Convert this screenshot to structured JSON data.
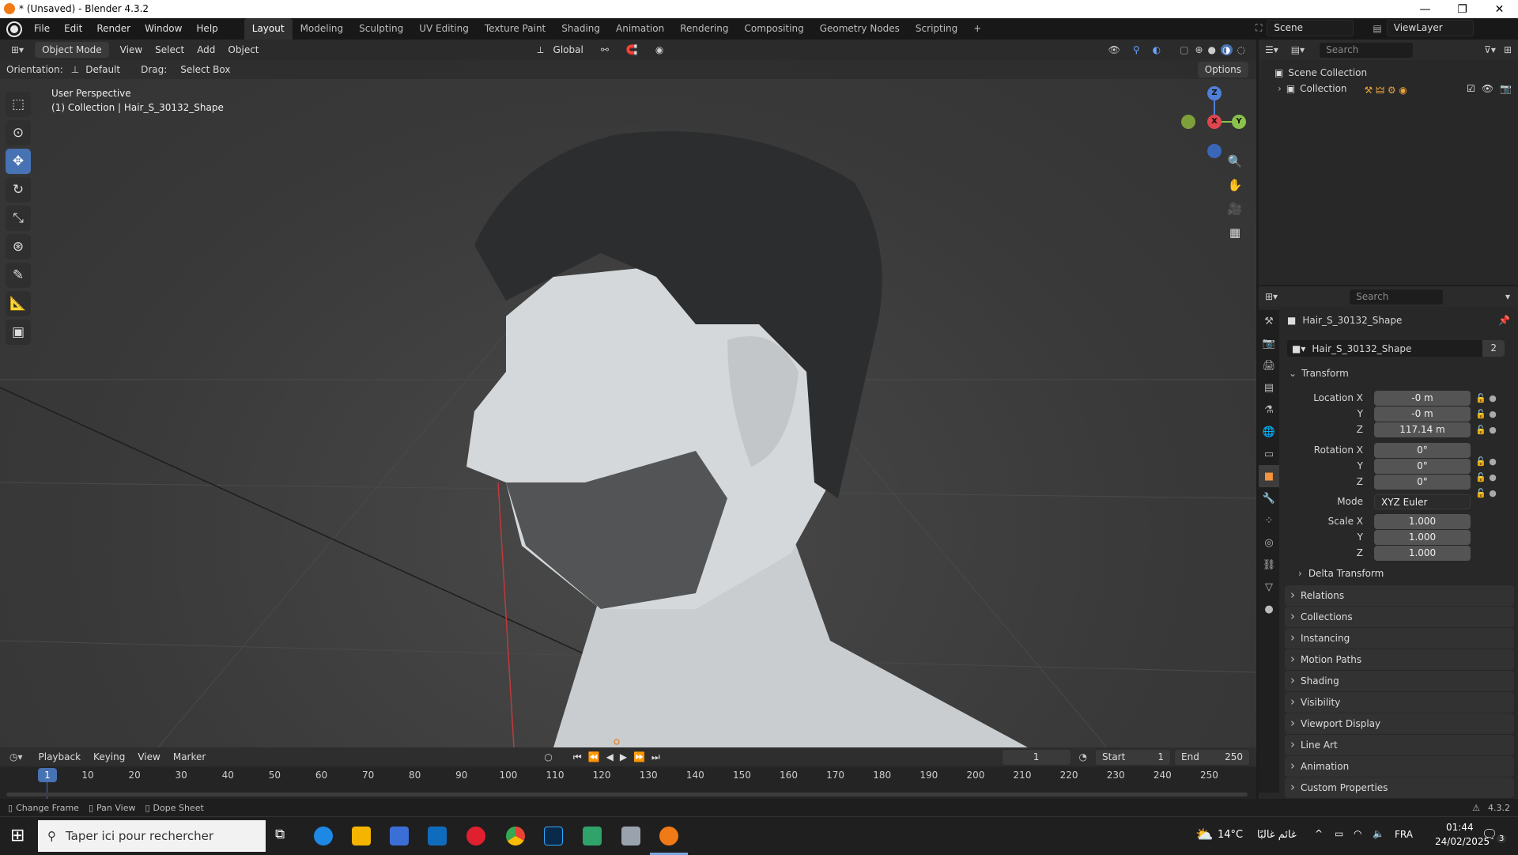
{
  "window": {
    "title": "* (Unsaved) - Blender 4.3.2",
    "controls": [
      "—",
      "❐",
      "✕"
    ]
  },
  "menu": [
    "File",
    "Edit",
    "Render",
    "Window",
    "Help"
  ],
  "workspaces": [
    "Layout",
    "Modeling",
    "Sculpting",
    "UV Editing",
    "Texture Paint",
    "Shading",
    "Animation",
    "Rendering",
    "Compositing",
    "Geometry Nodes",
    "Scripting",
    "+"
  ],
  "active_workspace": "Layout",
  "scene": {
    "label": "Scene",
    "view_layer": "ViewLayer"
  },
  "viewport": {
    "mode": "Object Mode",
    "header_menus": [
      "View",
      "Select",
      "Add",
      "Object"
    ],
    "transform_orientation": "Global",
    "orientation_label": "Orientation:",
    "orientation_value": "Default",
    "drag_label": "Drag:",
    "drag_value": "Select Box",
    "options": "Options",
    "perspective": "User Perspective",
    "active_info": "(1) Collection | Hair_S_30132_Shape",
    "gizmo": {
      "x": "X",
      "y": "Y",
      "z": "Z"
    }
  },
  "outliner": {
    "search_placeholder": "Search",
    "scene_collection": "Scene Collection",
    "collection": "Collection"
  },
  "properties": {
    "search_placeholder": "Search",
    "object_name": "Hair_S_30132_Shape",
    "data_name": "Hair_S_30132_Shape",
    "users": "2",
    "transform": {
      "title": "Transform",
      "location_label": "Location X",
      "location": [
        "-0 m",
        "-0 m",
        "117.14 m"
      ],
      "rotation_label": "Rotation X",
      "rotation": [
        "0°",
        "0°",
        "0°"
      ],
      "mode_label": "Mode",
      "mode": "XYZ Euler",
      "scale_label": "Scale X",
      "scale": [
        "1.000",
        "1.000",
        "1.000"
      ],
      "y_label": "Y",
      "z_label": "Z",
      "delta": "Delta Transform"
    },
    "panels": [
      "Relations",
      "Collections",
      "Instancing",
      "Motion Paths",
      "Shading",
      "Visibility",
      "Viewport Display",
      "Line Art",
      "Animation",
      "Custom Properties"
    ]
  },
  "timeline": {
    "menus": [
      "Playback",
      "Keying",
      "View",
      "Marker"
    ],
    "current_frame": "1",
    "start_label": "Start",
    "start": "1",
    "end_label": "End",
    "end": "250",
    "ticks": [
      "10",
      "20",
      "30",
      "40",
      "50",
      "60",
      "70",
      "80",
      "90",
      "100",
      "110",
      "120",
      "130",
      "140",
      "150",
      "160",
      "170",
      "180",
      "190",
      "200",
      "210",
      "220",
      "230",
      "240",
      "250"
    ],
    "playhead": "1"
  },
  "statusbar": {
    "items": [
      "Change Frame",
      "Pan View",
      "Dope Sheet"
    ],
    "version": "4.3.2"
  },
  "taskbar": {
    "search_placeholder": "Taper ici pour rechercher",
    "weather": "14°C",
    "weather_text": "غائم غالبًا",
    "language": "FRA",
    "time": "01:44",
    "date": "24/02/2025",
    "notifications": "3"
  }
}
